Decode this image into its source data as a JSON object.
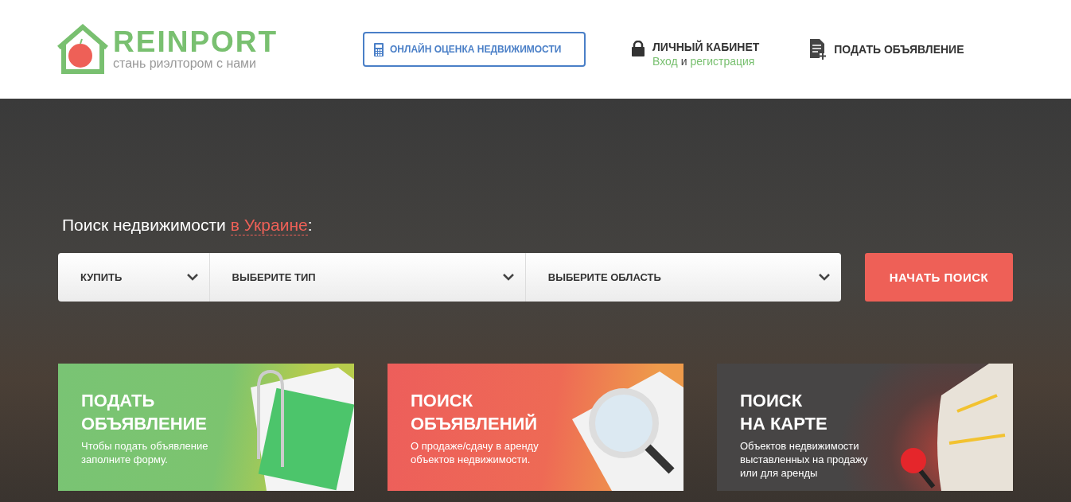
{
  "header": {
    "logo": {
      "name": "REINPORT",
      "tagline": "стань риэлтором с нами"
    },
    "valuation_button": "ОНЛАЙН ОЦЕНКА НЕДВИЖИМОСТИ",
    "account": {
      "title": "ЛИЧНЫЙ КАБИНЕТ",
      "login": "Вход",
      "conjunction": "и",
      "register": "регистрация"
    },
    "post_ad": "ПОДАТЬ ОБЪЯВЛЕНИЕ"
  },
  "search": {
    "heading": "Поиск недвижимости",
    "region": "в Украине",
    "colon": ":",
    "filters": [
      {
        "label": "КУПИТЬ"
      },
      {
        "label": "ВЫБЕРИТЕ ТИП"
      },
      {
        "label": "ВЫБЕРИТЕ ОБЛАСТЬ"
      }
    ],
    "submit": "НАЧАТЬ ПОИСК"
  },
  "cards": [
    {
      "kind": "post",
      "title_lines": [
        "ПОДАТЬ",
        "ОБЪЯВЛЕНИЕ"
      ],
      "description_lines": [
        "Чтобы подать объявление",
        "заполните форму."
      ]
    },
    {
      "kind": "search",
      "title_lines": [
        "ПОИСК",
        "ОБЪЯВЛЕНИЙ"
      ],
      "description_lines": [
        "О продаже/сдачу в аренду",
        "объектов недвижимости."
      ]
    },
    {
      "kind": "map",
      "title_lines": [
        "ПОИСК",
        "НА КАРТЕ"
      ],
      "description_lines": [
        "Объектов недвижимости",
        "выставленных на продажу",
        "или для аренды"
      ]
    }
  ]
}
